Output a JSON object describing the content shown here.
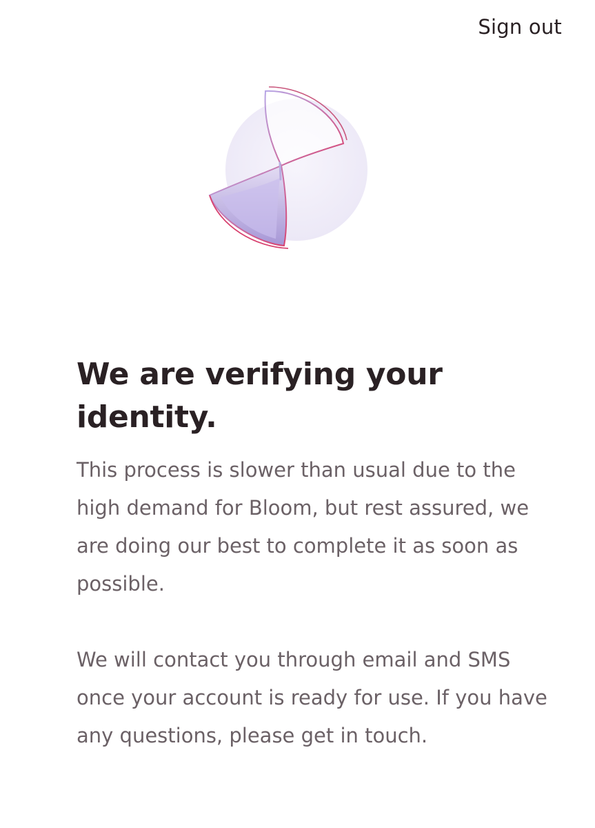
{
  "header": {
    "sign_out_label": "Sign out"
  },
  "illustration": {
    "icon": "hourglass-icon"
  },
  "main": {
    "title": "We are verifying your identity.",
    "paragraph_1": "This process is slower than usual due to the high demand for Bloom, but rest assured, we are doing our best to complete it as soon as possible.",
    "paragraph_2": "We will contact you through email and SMS once your account is ready for use. If you have any questions, please get in touch."
  },
  "colors": {
    "text_dark": "#2a2124",
    "text_body": "#6b6166",
    "accent_purple": "#b3a5e0",
    "accent_pink": "#d8426f"
  }
}
